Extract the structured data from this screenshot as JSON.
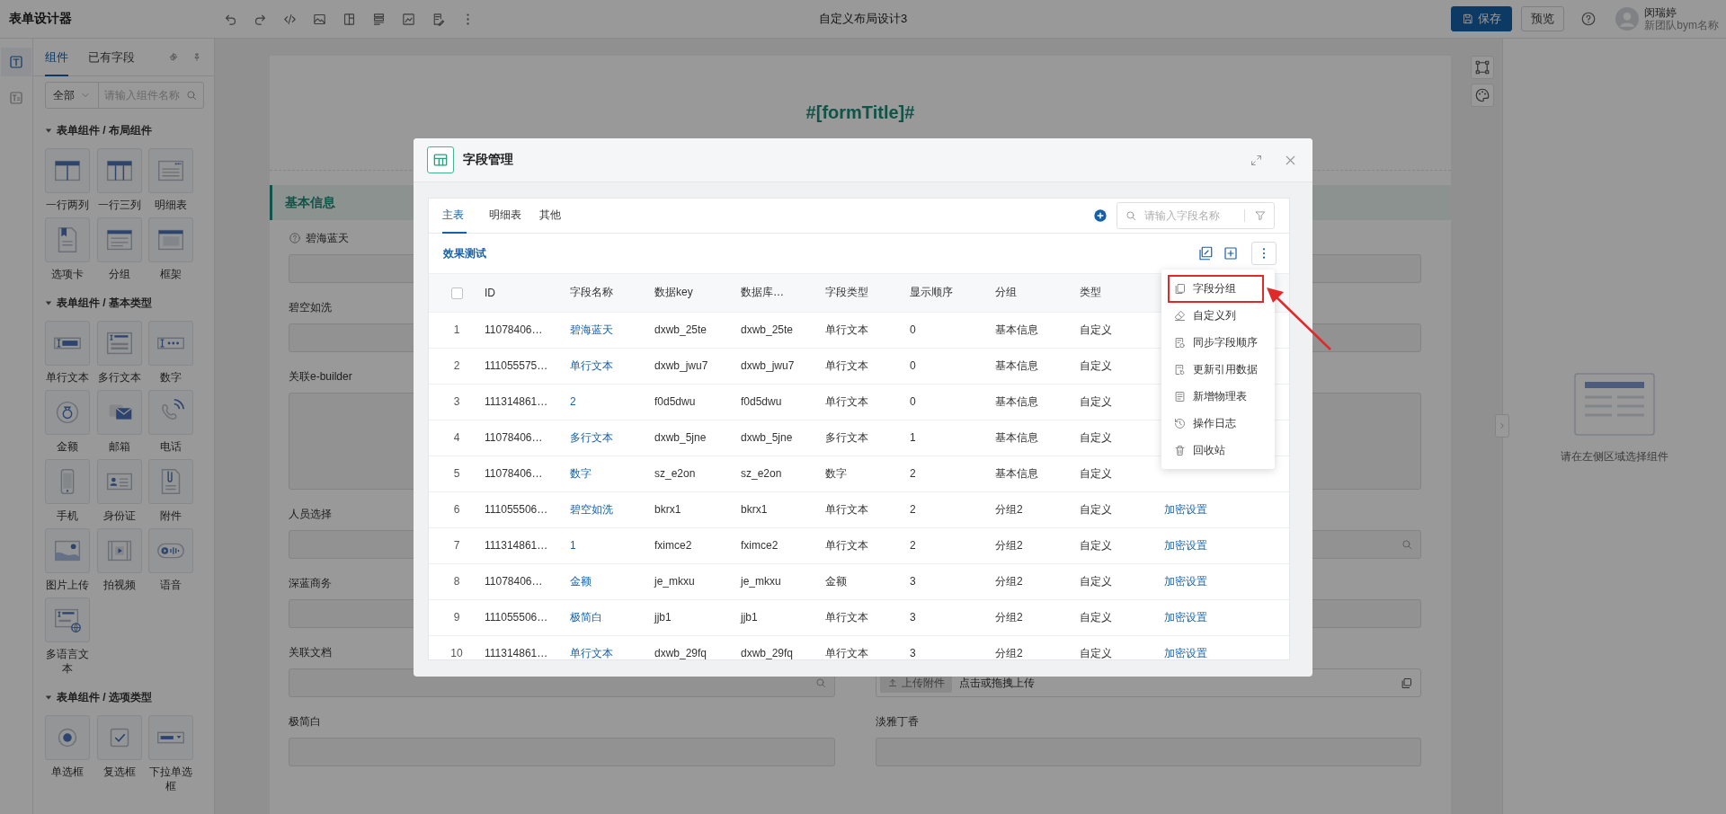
{
  "topbar": {
    "title": "表单设计器",
    "document_title": "自定义布局设计3",
    "save": "保存",
    "preview": "预览",
    "user": {
      "name": "闵瑞婷",
      "team": "新团队bym名称"
    }
  },
  "rail": [
    {
      "selected": true
    },
    {
      "selected": false
    }
  ],
  "sidebar": {
    "tabs": [
      {
        "label": "组件",
        "selected": true
      },
      {
        "label": "已有字段",
        "selected": false
      }
    ],
    "filter": "全部",
    "search_placeholder": "请输入组件名称",
    "groups": [
      {
        "title": "表单组件 / 布局组件",
        "expanded": true,
        "items": [
          "一行两列",
          "一行三列",
          "明细表",
          "选项卡",
          "分组",
          "框架"
        ]
      },
      {
        "title": "表单组件 / 基本类型",
        "expanded": true,
        "items": [
          "单行文本",
          "多行文本",
          "数字",
          "金额",
          "邮箱",
          "电话",
          "手机",
          "身份证",
          "附件",
          "图片上传",
          "拍视频",
          "语音",
          "多语言文本"
        ]
      },
      {
        "title": "表单组件 / 选项类型",
        "expanded": true,
        "items": [
          "单选框",
          "复选框",
          "下拉单选框"
        ]
      }
    ]
  },
  "form": {
    "title": "#[formTitle]#",
    "section": "基本信息",
    "items": [
      {
        "label": "碧海蓝天",
        "help": true,
        "kind": "text"
      },
      {
        "kind": "text"
      },
      {
        "label": "碧空如洗",
        "kind": "text"
      },
      {
        "kind": "text"
      },
      {
        "label": "关联e-builder",
        "kind": "textarea"
      },
      {
        "kind": "textarea"
      },
      {
        "label": "人员选择",
        "kind": "text"
      },
      {
        "kind": "search"
      },
      {
        "label": "深蓝商务",
        "kind": "text"
      },
      {
        "kind": "text"
      },
      {
        "label": "关联文档",
        "kind": "search"
      },
      {
        "kind": "upload",
        "button": "上传附件",
        "hint": "点击或拖拽上传"
      },
      {
        "label": "极简白",
        "kind": "text"
      },
      {
        "label": "淡雅丁香",
        "kind": "text"
      }
    ]
  },
  "right_panel": {
    "hint": "请在左侧区域选择组件"
  },
  "modal": {
    "title": "字段管理",
    "tabs": [
      {
        "label": "主表",
        "selected": true
      },
      {
        "label": "明细表",
        "selected": false
      },
      {
        "label": "其他",
        "selected": false
      }
    ],
    "search_placeholder": "请输入字段名称",
    "table_title": "效果测试",
    "select_all": {
      "checked": false
    },
    "columns": [
      "ID",
      "字段名称",
      "数据key",
      "数据库…",
      "字段类型",
      "显示顺序",
      "分组",
      "类型"
    ],
    "rows": [
      {
        "index": "1",
        "cells": [
          "11078406…",
          "碧海蓝天",
          "dxwb_25te",
          "dxwb_25te",
          "单行文本",
          "0",
          "基本信息",
          "自定义"
        ]
      },
      {
        "index": "2",
        "cells": [
          "111055575…",
          "单行文本",
          "dxwb_jwu7",
          "dxwb_jwu7",
          "单行文本",
          "0",
          "基本信息",
          "自定义"
        ]
      },
      {
        "index": "3",
        "cells": [
          "111314861…",
          "2",
          "f0d5dwu",
          "f0d5dwu",
          "单行文本",
          "0",
          "基本信息",
          "自定义"
        ]
      },
      {
        "index": "4",
        "cells": [
          "11078406…",
          "多行文本",
          "dxwb_5jne",
          "dxwb_5jne",
          "多行文本",
          "1",
          "基本信息",
          "自定义"
        ]
      },
      {
        "index": "5",
        "cells": [
          "11078406…",
          "数字",
          "sz_e2on",
          "sz_e2on",
          "数字",
          "2",
          "基本信息",
          "自定义"
        ]
      },
      {
        "index": "6",
        "cells": [
          "111055506…",
          "碧空如洗",
          "bkrx1",
          "bkrx1",
          "单行文本",
          "2",
          "分组2",
          "自定义"
        ],
        "action": "加密设置"
      },
      {
        "index": "7",
        "cells": [
          "111314861…",
          "1",
          "fximce2",
          "fximce2",
          "单行文本",
          "2",
          "分组2",
          "自定义"
        ],
        "action": "加密设置"
      },
      {
        "index": "8",
        "cells": [
          "11078406…",
          "金额",
          "je_mkxu",
          "je_mkxu",
          "金额",
          "3",
          "分组2",
          "自定义"
        ],
        "action": "加密设置"
      },
      {
        "index": "9",
        "cells": [
          "111055506…",
          "极简白",
          "jjb1",
          "jjb1",
          "单行文本",
          "3",
          "分组2",
          "自定义"
        ],
        "action": "加密设置"
      },
      {
        "index": "10",
        "cells": [
          "111314861…",
          "单行文本",
          "dxwb_29fq",
          "dxwb_29fq",
          "单行文本",
          "3",
          "分组2",
          "自定义"
        ],
        "action": "加密设置"
      }
    ],
    "menu": [
      {
        "label": "字段分组",
        "annotated": true
      },
      {
        "label": "自定义列",
        "annotated": false
      },
      {
        "label": "同步字段顺序",
        "annotated": false
      },
      {
        "label": "更新引用数据",
        "annotated": false
      },
      {
        "label": "新增物理表",
        "annotated": false
      },
      {
        "label": "操作日志",
        "annotated": false
      },
      {
        "label": "回收站",
        "annotated": false
      }
    ]
  }
}
